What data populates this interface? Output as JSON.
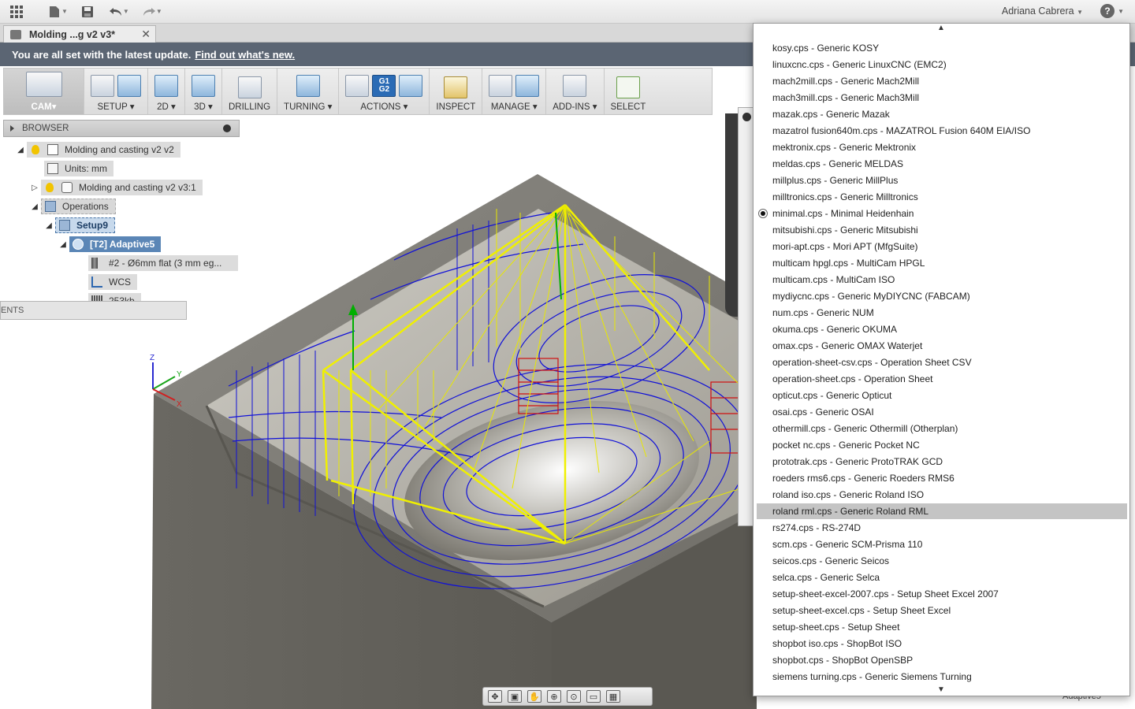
{
  "appbar": {
    "user_name": "Adriana Cabrera",
    "help_symbol": "?"
  },
  "document_tab": {
    "title": "Molding ...g v2 v3*",
    "close_symbol": "✕"
  },
  "banner": {
    "message": "You are all set with the latest update.",
    "link": "Find out what's new."
  },
  "toolbar": {
    "groups": [
      {
        "label": "CAM▾"
      },
      {
        "label": "SETUP ▾"
      },
      {
        "label": "2D ▾"
      },
      {
        "label": "3D ▾"
      },
      {
        "label": "DRILLING"
      },
      {
        "label": "TURNING ▾"
      },
      {
        "label": "ACTIONS ▾"
      },
      {
        "label": "INSPECT"
      },
      {
        "label": "MANAGE ▾"
      },
      {
        "label": "ADD-INS ▾"
      },
      {
        "label": "SELECT"
      }
    ],
    "g1g2": "G1 G2"
  },
  "browser": {
    "title": "BROWSER",
    "nodes": {
      "root": "Molding and casting v2 v2",
      "units": "Units: mm",
      "component": "Molding and casting v2 v3:1",
      "operations": "Operations",
      "setup": "Setup9",
      "operation": "[T2] Adaptive5",
      "tool": "#2 - Ø6mm flat (3 mm eg...",
      "wcs": "WCS",
      "size": "253kb"
    },
    "comments_label": "ENTS"
  },
  "triad": {
    "z": "Z",
    "y": "Y",
    "x": "X"
  },
  "post_list": {
    "selected": "minimal.cps - Minimal Heidenhain",
    "highlighted": "roland rml.cps - Generic Roland RML",
    "items": [
      "kosy.cps - Generic KOSY",
      "linuxcnc.cps - Generic LinuxCNC (EMC2)",
      "mach2mill.cps - Generic Mach2Mill",
      "mach3mill.cps - Generic Mach3Mill",
      "mazak.cps - Generic Mazak",
      "mazatrol fusion640m.cps - MAZATROL Fusion 640M EIA/ISO",
      "mektronix.cps - Generic Mektronix",
      "meldas.cps - Generic MELDAS",
      "millplus.cps - Generic MillPlus",
      "milltronics.cps - Generic Milltronics",
      "minimal.cps - Minimal Heidenhain",
      "mitsubishi.cps - Generic Mitsubishi",
      "mori-apt.cps - Mori APT (MfgSuite)",
      "multicam hpgl.cps - MultiCam HPGL",
      "multicam.cps - MultiCam ISO",
      "mydiycnc.cps - Generic MyDIYCNC (FABCAM)",
      "num.cps - Generic NUM",
      "okuma.cps - Generic OKUMA",
      "omax.cps - Generic OMAX Waterjet",
      "operation-sheet-csv.cps - Operation Sheet CSV",
      "operation-sheet.cps - Operation Sheet",
      "opticut.cps - Generic Opticut",
      "osai.cps - Generic OSAI",
      "othermill.cps - Generic Othermill (Otherplan)",
      "pocket nc.cps - Generic Pocket NC",
      "prototrak.cps - Generic ProtoTRAK GCD",
      "roeders rms6.cps - Generic Roeders RMS6",
      "roland iso.cps - Generic Roland ISO",
      "roland rml.cps - Generic Roland RML",
      "rs274.cps - RS-274D",
      "scm.cps - Generic SCM-Prisma 110",
      "seicos.cps - Generic Seicos",
      "selca.cps - Generic Selca",
      "setup-sheet-excel-2007.cps - Setup Sheet Excel 2007",
      "setup-sheet-excel.cps - Setup Sheet Excel",
      "setup-sheet.cps - Setup Sheet",
      "shopbot iso.cps - ShopBot ISO",
      "shopbot.cps - ShopBot OpenSBP",
      "siemens turning.cps - Generic Siemens Turning"
    ],
    "scroll_up": "▲",
    "scroll_down": "▼"
  },
  "bottom_label": "Adaptive5"
}
